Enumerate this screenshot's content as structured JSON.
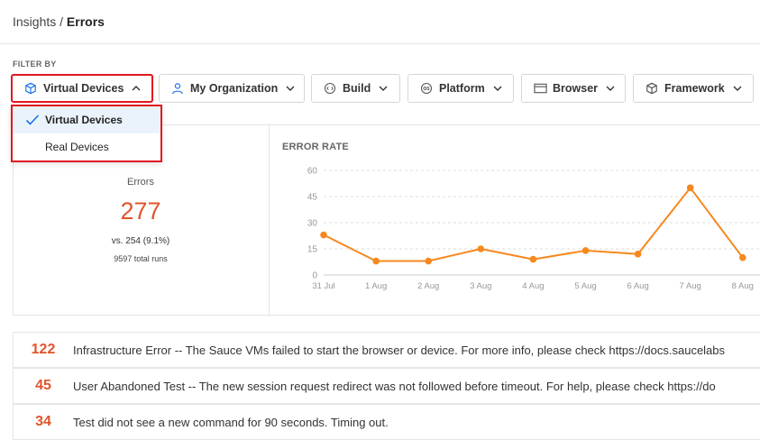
{
  "breadcrumb": {
    "parent": "Insights",
    "separator": " / ",
    "current": "Errors"
  },
  "filters": {
    "label": "FILTER BY",
    "buttons": [
      {
        "label": "Virtual Devices",
        "icon": "cube-icon"
      },
      {
        "label": "My Organization",
        "icon": "user-icon"
      },
      {
        "label": "Build",
        "icon": "build-icon"
      },
      {
        "label": "Platform",
        "icon": "os-icon"
      },
      {
        "label": "Browser",
        "icon": "browser-window-icon"
      },
      {
        "label": "Framework",
        "icon": "cube-icon"
      }
    ],
    "dropdown": {
      "options": [
        "Virtual Devices",
        "Real Devices"
      ],
      "selected": "Virtual Devices"
    }
  },
  "stats": {
    "title": "Errors",
    "count": "277",
    "comparison": "vs. 254 (9.1%)",
    "total_runs": "9597 total runs"
  },
  "chart_data": {
    "type": "line",
    "title": "ERROR RATE",
    "categories": [
      "31 Jul",
      "1 Aug",
      "2 Aug",
      "3 Aug",
      "4 Aug",
      "5 Aug",
      "6 Aug",
      "7 Aug",
      "8 Aug"
    ],
    "values": [
      23,
      8,
      8,
      15,
      9,
      14,
      12,
      50,
      10
    ],
    "yticks": [
      0,
      15,
      30,
      45,
      60
    ],
    "ylim": [
      0,
      60
    ],
    "grid": true,
    "color": "#f5891f"
  },
  "errors": [
    {
      "count": "122",
      "message": "Infrastructure Error -- The Sauce VMs failed to start the browser or device. For more info, please check https://docs.saucelabs"
    },
    {
      "count": "45",
      "message": "User Abandoned Test -- The new session request redirect was not followed before timeout. For help, please check https://do"
    },
    {
      "count": "34",
      "message": "Test did not see a new command for 90 seconds. Timing out."
    }
  ],
  "colors": {
    "accent": "#e0542a",
    "line": "#f5891f",
    "highlight": "#e3181e",
    "selected_bg": "#eaf3fc",
    "blue_icon": "#1a73e8"
  }
}
